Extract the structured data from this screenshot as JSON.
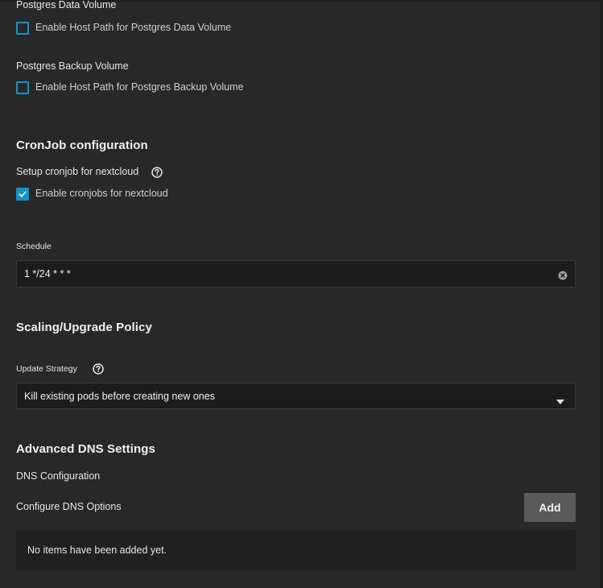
{
  "postgres_data": {
    "heading": "Postgres Data Volume",
    "checkbox_label": "Enable Host Path for Postgres Data Volume",
    "checked": false
  },
  "postgres_backup": {
    "heading": "Postgres Backup Volume",
    "checkbox_label": "Enable Host Path for Postgres Backup Volume",
    "checked": false
  },
  "cronjob": {
    "title": "CronJob configuration",
    "setup_label": "Setup cronjob for nextcloud",
    "checkbox_label": "Enable cronjobs for nextcloud",
    "checked": true,
    "schedule_label": "Schedule",
    "schedule_value": "1 */24 * * *"
  },
  "scaling": {
    "title": "Scaling/Upgrade Policy",
    "strategy_label": "Update Strategy",
    "strategy_value": "Kill existing pods before creating new ones"
  },
  "dns": {
    "title": "Advanced DNS Settings",
    "config_label": "DNS Configuration",
    "options_label": "Configure DNS Options",
    "add_label": "Add",
    "empty_text": "No items have been added yet."
  },
  "colors": {
    "background": "#282828",
    "accent": "#0b95c9",
    "input_bg": "#1c1c1c",
    "button_bg": "#5a5a5a"
  }
}
